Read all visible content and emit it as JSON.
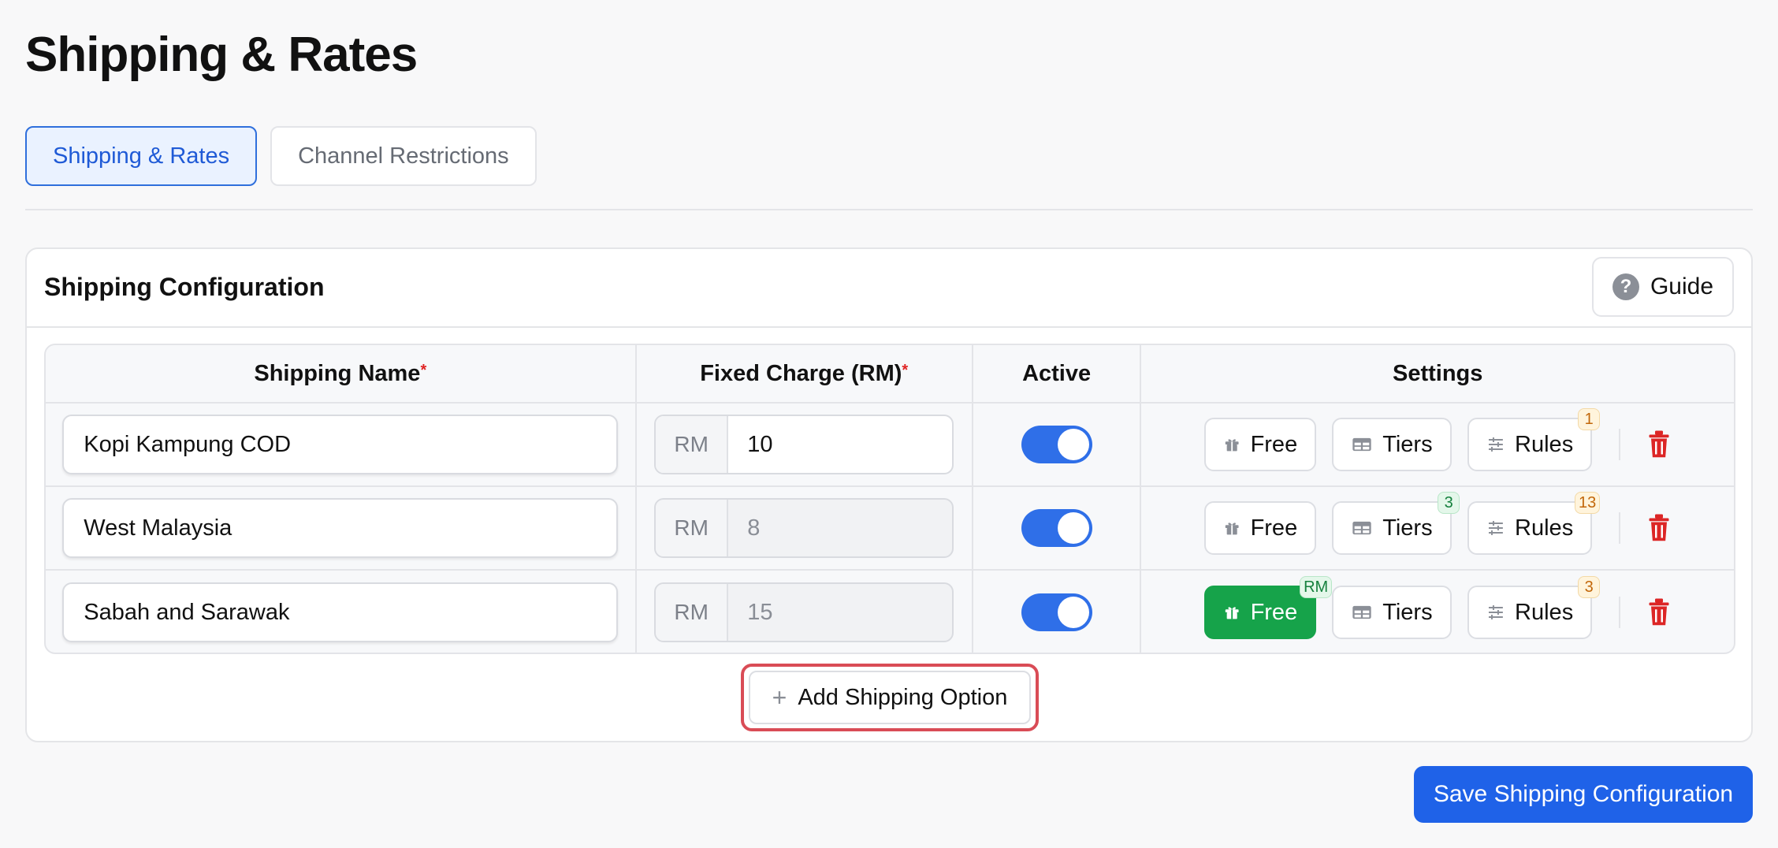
{
  "page": {
    "title": "Shipping & Rates"
  },
  "tabs": [
    {
      "label": "Shipping & Rates",
      "active": true
    },
    {
      "label": "Channel Restrictions",
      "active": false
    }
  ],
  "card": {
    "title": "Shipping Configuration",
    "guide_label": "Guide",
    "guide_icon": "question-circle-icon"
  },
  "table": {
    "headers": {
      "name": "Shipping Name",
      "charge": "Fixed Charge (RM)",
      "active": "Active",
      "settings": "Settings",
      "required_mark": "*"
    },
    "currency_prefix": "RM",
    "rows": [
      {
        "name": "Kopi Kampung COD",
        "charge": "10",
        "active": true,
        "free_label": "Free",
        "tiers_label": "Tiers",
        "rules_label": "Rules",
        "tiers_badge": "",
        "rules_badge": "1",
        "free_badge": ""
      },
      {
        "name": "West Malaysia",
        "charge": "8",
        "active": true,
        "free_label": "Free",
        "tiers_label": "Tiers",
        "rules_label": "Rules",
        "tiers_badge": "3",
        "rules_badge": "13",
        "free_badge": ""
      },
      {
        "name": "Sabah and Sarawak",
        "charge": "15",
        "active": true,
        "free_label": "Free",
        "tiers_label": "Tiers",
        "rules_label": "Rules",
        "tiers_badge": "",
        "rules_badge": "3",
        "free_badge": "RM"
      }
    ]
  },
  "actions": {
    "add_label": "Add Shipping Option",
    "save_label": "Save Shipping Configuration"
  },
  "colors": {
    "primary": "#1f62e8",
    "toggle_on": "#2f6fe8",
    "free_active": "#16a34a",
    "danger": "#dc2626",
    "highlight_border": "#d94c56"
  }
}
